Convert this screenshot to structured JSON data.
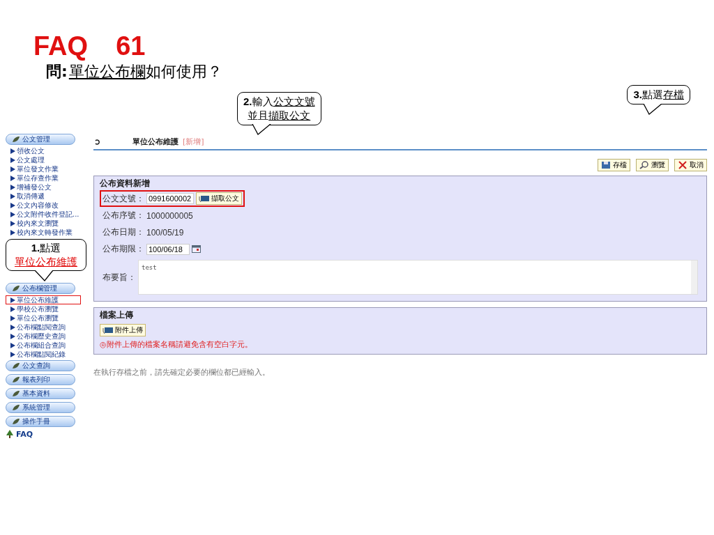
{
  "slide": {
    "title": "FAQ",
    "number": "61"
  },
  "question": {
    "label": "問:",
    "parts": [
      {
        "text": "單位公布欄",
        "kind": "underline"
      },
      {
        "text": "如何使用？",
        "kind": "plain"
      }
    ]
  },
  "annotations": [
    {
      "lines": [
        [
          {
            "text": "2.",
            "kind": "bold"
          },
          {
            "text": "輸入",
            "kind": "plain"
          },
          {
            "text": "公文文號",
            "kind": "underline"
          }
        ],
        [
          {
            "text": "並且",
            "kind": "plain"
          },
          {
            "text": "擷取公文",
            "kind": "underline"
          }
        ]
      ]
    },
    {
      "lines": [
        [
          {
            "text": "3.",
            "kind": "bold"
          },
          {
            "text": "點選",
            "kind": "plain"
          },
          {
            "text": "存檔",
            "kind": "underline"
          }
        ]
      ]
    }
  ],
  "sidebar": {
    "groups": [
      {
        "label": "公文管理",
        "items": [
          {
            "label": "領收公文",
            "highlighted": false
          },
          {
            "label": "公文處理",
            "highlighted": false
          },
          {
            "label": "單位發文作業",
            "highlighted": false
          },
          {
            "label": "單位存查作業",
            "highlighted": false
          },
          {
            "label": "增補發公文",
            "highlighted": false
          },
          {
            "label": "取消傳遞",
            "highlighted": false
          },
          {
            "label": "公文內容修改",
            "highlighted": false
          },
          {
            "label": "公文附件收件登記...",
            "highlighted": false
          },
          {
            "label": "校內來文瀏覽",
            "highlighted": false
          },
          {
            "label": "校內來文轉發作業",
            "highlighted": false
          }
        ]
      },
      {
        "label": "公布欄管理",
        "items": [
          {
            "label": "單位公布維護",
            "highlighted": true
          },
          {
            "label": "學校公布瀏覽",
            "highlighted": false
          },
          {
            "label": "單位公布瀏覽",
            "highlighted": false
          },
          {
            "label": "公布欄點閱查詢",
            "highlighted": false
          },
          {
            "label": "公布欄歷史查詢",
            "highlighted": false
          },
          {
            "label": "公布欄組合查詢",
            "highlighted": false
          },
          {
            "label": "公布欄點閱紀錄",
            "highlighted": false
          }
        ]
      },
      {
        "label": "公文查詢"
      },
      {
        "label": "報表列印"
      },
      {
        "label": "基本資料"
      },
      {
        "label": "系統管理"
      },
      {
        "label": "操作手冊"
      }
    ],
    "callout": {
      "lines": [
        [
          {
            "text": "1.",
            "kind": "bold"
          },
          {
            "text": "點選",
            "kind": "plain"
          }
        ],
        [
          {
            "text": "單位公布維護",
            "kind": "red-underline"
          }
        ]
      ]
    },
    "faq_link": "FAQ"
  },
  "page": {
    "title": "單位公布維護",
    "tag": "[新增]"
  },
  "toolbar": [
    "存檔",
    "瀏覽",
    "取消"
  ],
  "form": {
    "legend": "公布資料新增",
    "doc_no": {
      "label": "公文文號：",
      "value": "0991600002",
      "button": "擷取公文",
      "highlighted": true
    },
    "serial": {
      "label": "公布序號：",
      "value": "1000000005"
    },
    "date": {
      "label": "公布日期：",
      "value": "100/05/19"
    },
    "deadline": {
      "label": "公布期限：",
      "value": "100/06/18"
    },
    "summary": {
      "label": "布要旨：",
      "value": "test"
    }
  },
  "upload": {
    "legend": "檔案上傳",
    "button": "附件上傳",
    "note": "◎附件上傳的檔案名稱請避免含有空白字元。"
  },
  "footer_note": "在執行存檔之前，請先確定必要的欄位都已經輸入。"
}
